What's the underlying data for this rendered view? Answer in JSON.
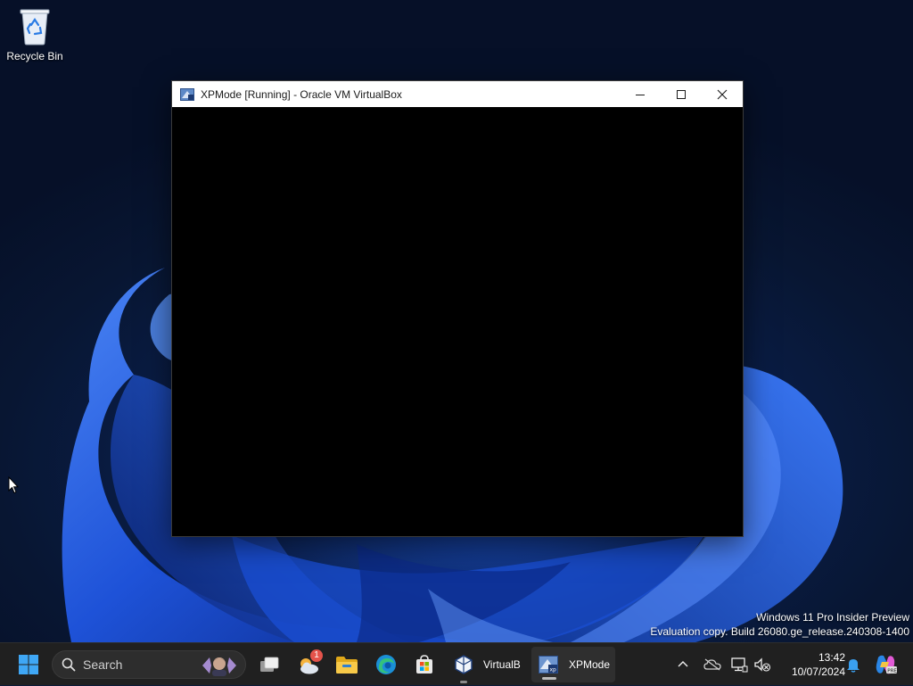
{
  "desktop": {
    "recycle_bin_label": "Recycle Bin",
    "watermark": {
      "line1": "Windows 11 Pro Insider Preview",
      "line2": "Evaluation copy. Build 26080.ge_release.240308-1400"
    }
  },
  "window": {
    "title": "XPMode [Running] - Oracle VM VirtualBox",
    "icon": "virtualbox-xp-icon",
    "controls": [
      "minimize-icon",
      "maximize-icon",
      "close-icon"
    ]
  },
  "taskbar": {
    "search_placeholder": "Search",
    "apps": [
      {
        "name": "task-view",
        "icon": "task-view-icon"
      },
      {
        "name": "widgets",
        "icon": "weather-widget-icon",
        "badge": "1"
      },
      {
        "name": "file-explorer",
        "icon": "folder-icon"
      },
      {
        "name": "edge",
        "icon": "edge-icon"
      },
      {
        "name": "store",
        "icon": "store-icon"
      },
      {
        "name": "virtualbox",
        "icon": "virtualbox-icon",
        "label": "VirtualB"
      },
      {
        "name": "xpmode",
        "icon": "virtualbox-xp-icon",
        "label": "XPMode"
      }
    ],
    "tray": {
      "time": "13:42",
      "date": "10/07/2024",
      "icons": [
        "chevron-up-icon",
        "onedrive-icon",
        "network-icon",
        "volume-muted-icon",
        "notification-bell-icon",
        "copilot-icon"
      ]
    }
  },
  "colors": {
    "taskbar_bg": "#202020",
    "wallpaper_dark": "#081632",
    "wallpaper_bloom": "#1e5ae6"
  }
}
